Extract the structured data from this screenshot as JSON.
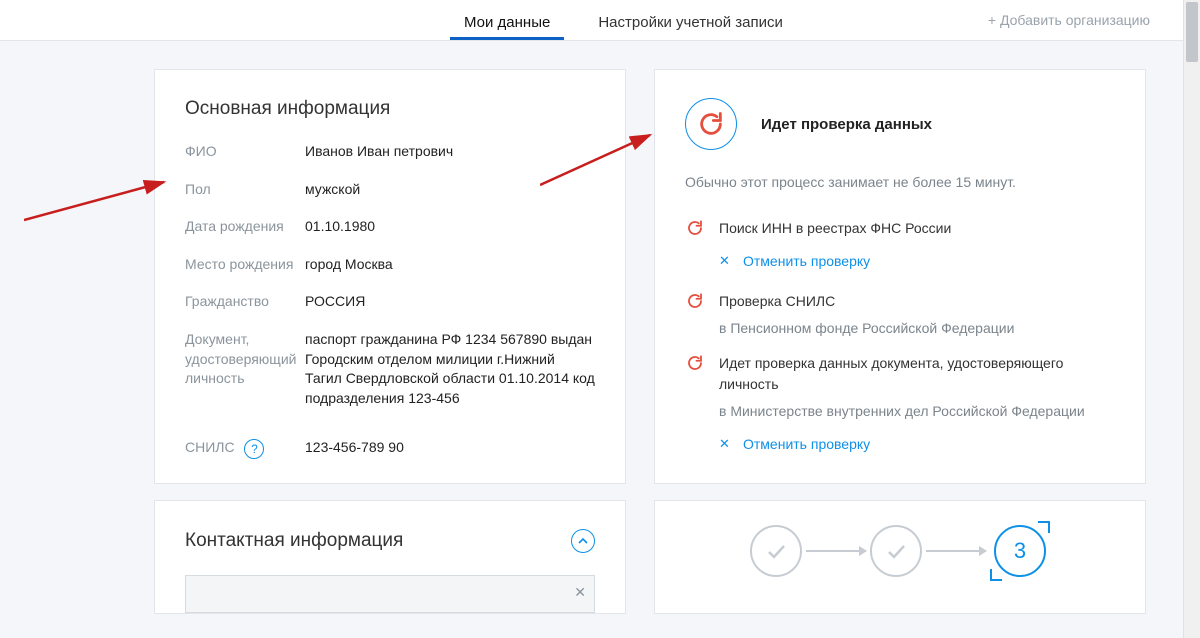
{
  "nav": {
    "tab_my_data": "Мои данные",
    "tab_account_settings": "Настройки учетной записи",
    "add_org": "+ Добавить организацию"
  },
  "main_info": {
    "title": "Основная информация",
    "labels": {
      "fio": "ФИО",
      "gender": "Пол",
      "dob": "Дата рождения",
      "birthplace": "Место рождения",
      "citizenship": "Гражданство",
      "doc": "Документ, удостоверяющий личность",
      "snils": "СНИЛС"
    },
    "values": {
      "fio": "Иванов Иван петрович",
      "gender": "мужской",
      "dob": "01.10.1980",
      "birthplace": "город Москва",
      "citizenship": "РОССИЯ",
      "doc": "паспорт гражданина РФ 1234 567890 выдан Городским отделом милиции г.Нижний Тагил Свердловской области 01.10.2014 код подразделения 123-456",
      "snils": "123-456-789 90"
    },
    "help_glyph": "?"
  },
  "verify": {
    "title": "Идет проверка данных",
    "note": "Обычно этот процесс занимает не более 15 минут.",
    "items": {
      "inn": "Поиск ИНН в реестрах ФНС России",
      "cancel": "Отменить проверку",
      "snils": "Проверка СНИЛС",
      "snils_sub": "в Пенсионном фонде Российской Федерации",
      "doc": "Идет проверка данных документа, удостоверяющего личность",
      "doc_sub": "в Министерстве внутренних дел Российской Федерации"
    }
  },
  "contacts": {
    "title": "Контактная информация"
  },
  "progress": {
    "step3": "3"
  }
}
